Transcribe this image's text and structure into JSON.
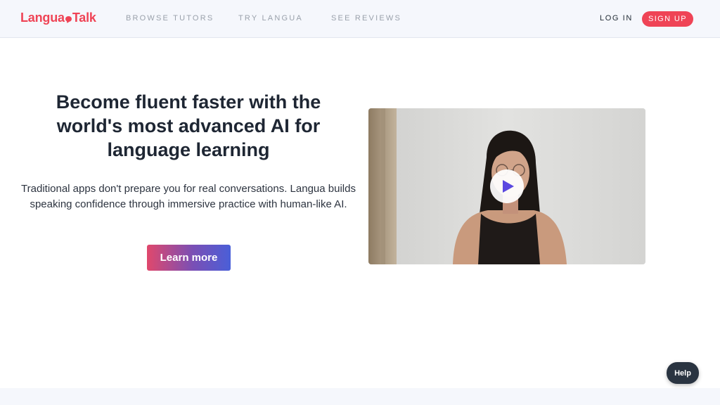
{
  "brand": {
    "name_part1": "Langua",
    "name_part2": "Talk",
    "color": "#ef4456"
  },
  "nav": {
    "browse_tutors": "BROWSE TUTORS",
    "try_langua": "TRY LANGUA",
    "see_reviews": "SEE REVIEWS",
    "log_in": "LOG IN",
    "sign_up": "SIGN UP"
  },
  "hero": {
    "title": "Become fluent faster with the world's most advanced AI for language learning",
    "description": "Traditional apps don't prepare you for real conversations. Langua builds speaking confidence through immersive practice with human-like AI.",
    "cta_label": "Learn more",
    "cta_gradient": [
      "#e0486c",
      "#4a5fd8"
    ]
  },
  "video": {
    "icon": "play-icon",
    "play_color": "#5a48e0"
  },
  "help": {
    "label": "Help"
  }
}
